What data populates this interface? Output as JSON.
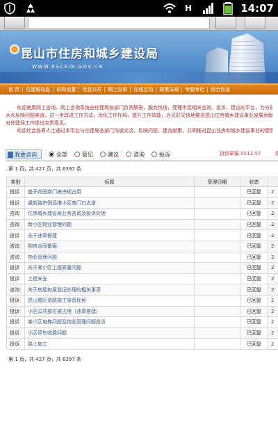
{
  "status_bar": {
    "time": "14:07",
    "icons": [
      "shield-icon",
      "recycle-icon",
      "wifi-icon",
      "h-network-icon",
      "signal-icon",
      "battery-icon"
    ]
  },
  "site": {
    "title": "昆山市住房和城乡建设局",
    "url": "WWW.KSCEIN.GOV.CN"
  },
  "nav": {
    "items": [
      "首 页",
      "住建局动态",
      "机构设置",
      "信息公开",
      "网上办事",
      "在线互动",
      "政策法规",
      "专题专栏",
      "综合信息"
    ]
  },
  "intro": {
    "line1": "欢迎使用网上咨询，网上咨询系统由住建局各部门负责解答，服务热线，受理市民相关咨询、投诉、建议的平台，为方便社会各界人士",
    "line2": "大众反映问题渠道，进一步改进工作方法，优化工作作风，提升工作效能，为又好又快地推进昆山住房城乡建设事业发展贡献力量，欢迎",
    "line3": "对住建局工作提出宝贵意见。",
    "line4": "欢迎社会各界人士通过本平台与住建局各部门沟通交流，反映问题，建言献策，共同推进昆山住房和城乡建设事业的健康发展"
  },
  "filter": {
    "ask_button": "我要咨询",
    "options": [
      "全部",
      "意见",
      "建议",
      "咨询",
      "投诉"
    ],
    "selected_index": 0,
    "link": "投诉举报 0512-57",
    "link_tail": "受"
  },
  "pager": {
    "text": "第 1 页，共 427 页，共 6397 条"
  },
  "table": {
    "headers": [
      "类别",
      "标题",
      "受理日期",
      "状态",
      ""
    ],
    "rows": [
      {
        "category": "投诉",
        "title": "盛天花园南门被违规占用",
        "date": "",
        "status": "已回复",
        "last": "2"
      },
      {
        "category": "投诉",
        "title": "虞新路东侧远港小区南门口占道",
        "date": "",
        "status": "已回复",
        "last": "2"
      },
      {
        "category": "咨询",
        "title": "住房城乡建设局业务咨询及投诉处理",
        "date": "",
        "status": "已回复",
        "last": "2"
      },
      {
        "category": "咨询",
        "title": "新小区物业管理问题",
        "date": "",
        "status": "已回复",
        "last": "2"
      },
      {
        "category": "投诉",
        "title": "关于违章搭建",
        "date": "",
        "status": "已回复",
        "last": "2"
      },
      {
        "category": "咨询",
        "title": "购房合同备案",
        "date": "",
        "status": "已回复",
        "last": "2"
      },
      {
        "category": "咨询",
        "title": "物业管理问题",
        "date": "",
        "status": "已回复",
        "last": "2"
      },
      {
        "category": "投诉",
        "title": "关于某小区工程质量问题",
        "date": "",
        "status": "已回复",
        "last": "2"
      },
      {
        "category": "投诉",
        "title": "工程安全",
        "date": "",
        "status": "已回复",
        "last": "2"
      },
      {
        "category": "咨询",
        "title": "关于房屋权属登记办理的相关事项",
        "date": "",
        "status": "已回复",
        "last": "2"
      },
      {
        "category": "投诉",
        "title": "昆山城区道路施工噪音扰民",
        "date": "",
        "status": "已回复",
        "last": "2"
      },
      {
        "category": "投诉",
        "title": "小区公共部位被占用（违章搭建）",
        "date": "",
        "status": "已回复",
        "last": "2"
      },
      {
        "category": "投诉",
        "title": "某小区电梯问题及物业管理问题投诉",
        "date": "",
        "status": "已回复",
        "last": "2"
      },
      {
        "category": "投诉",
        "title": "小区停车收费问题",
        "date": "",
        "status": "已回复",
        "last": "2"
      },
      {
        "category": "投诉",
        "title": "路上施工",
        "date": "",
        "status": "已回复",
        "last": "2"
      }
    ]
  }
}
